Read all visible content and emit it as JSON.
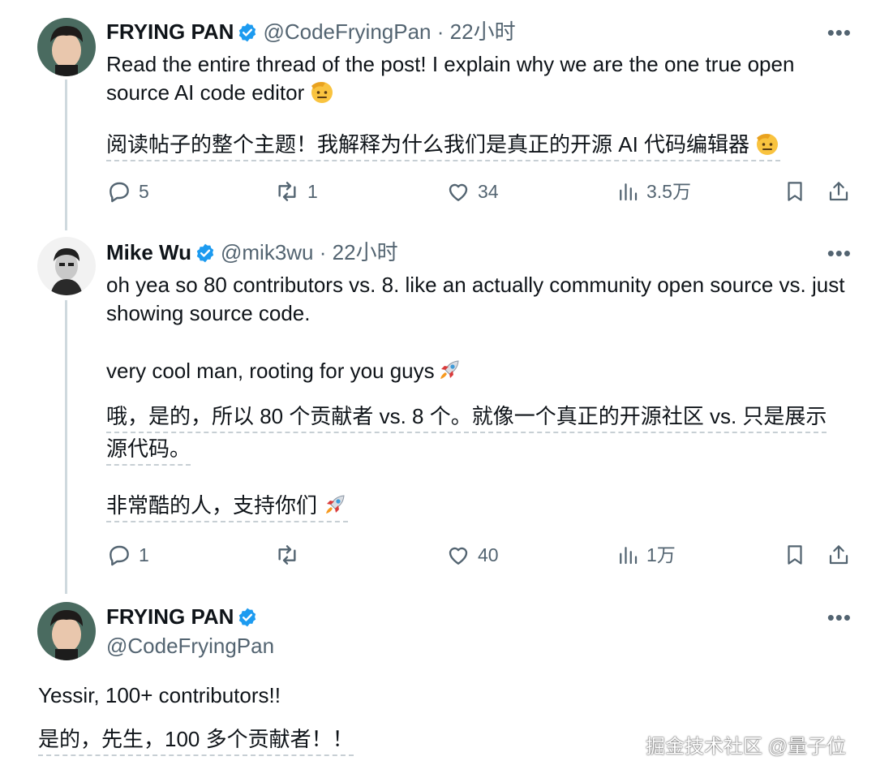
{
  "tweets": [
    {
      "name": "FRYING PAN",
      "handle": "@CodeFryingPan",
      "time": "22小时",
      "text_en": "Read the entire thread of the post! I explain why we are the one true open source AI code editor",
      "text_zh": "阅读帖子的整个主题！我解释为什么我们是真正的开源 AI 代码编辑器",
      "emoji": "saluting-face-emoji",
      "replies": "5",
      "retweets": "1",
      "likes": "34",
      "views": "3.5万"
    },
    {
      "name": "Mike Wu",
      "handle": "@mik3wu",
      "time": "22小时",
      "text_en_1": "oh yea so 80 contributors vs. 8. like an actually community open source vs. just showing source code.",
      "text_en_2": "very cool man, rooting for you guys",
      "text_zh_1": "哦，是的，所以 80 个贡献者 vs. 8 个。就像一个真正的开源社区 vs. 只是展示源代码。",
      "text_zh_2": "非常酷的人，支持你们",
      "emoji": "rocket-emoji",
      "replies": "1",
      "retweets": "",
      "likes": "40",
      "views": "1万"
    },
    {
      "name": "FRYING PAN",
      "handle": "@CodeFryingPan",
      "text_en": "Yessir, 100+ contributors!!",
      "text_zh": "是的，先生，100 多个贡献者！！"
    }
  ],
  "more_label": "•••",
  "separator": "·",
  "watermark": "掘金技术社区 @量子位",
  "colors": {
    "verified": "#1d9bf0",
    "muted": "#536471",
    "thread_line": "#cfd9de"
  }
}
